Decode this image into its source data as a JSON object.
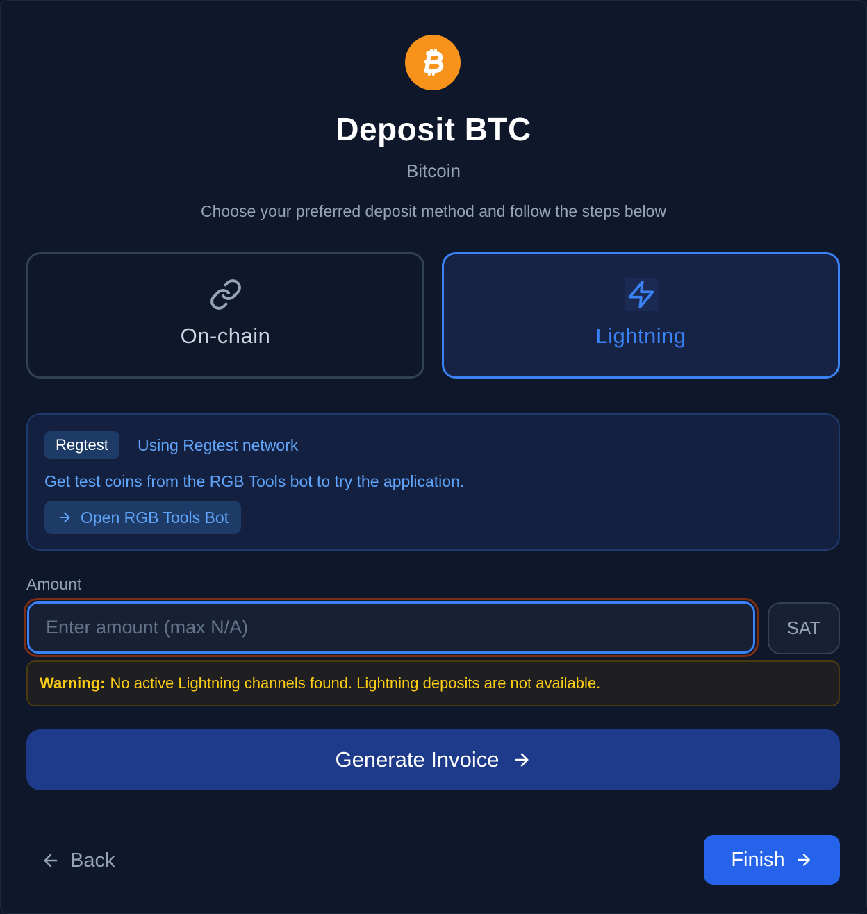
{
  "header": {
    "logo_icon": "bitcoin-icon",
    "logo_color": "#f7931a",
    "title": "Deposit BTC",
    "subtitle": "Bitcoin",
    "instructions": "Choose your preferred deposit method and follow the steps below"
  },
  "methods": [
    {
      "label": "On-chain",
      "icon": "link-icon",
      "selected": false
    },
    {
      "label": "Lightning",
      "icon": "lightning-icon",
      "selected": true
    }
  ],
  "regtest": {
    "badge": "Regtest",
    "network_text": "Using Regtest network",
    "description": "Get test coins from the RGB Tools bot to try the application.",
    "bot_button_label": "Open RGB Tools Bot"
  },
  "amount": {
    "label": "Amount",
    "placeholder": "Enter amount (max N/A)",
    "value": "",
    "unit": "SAT"
  },
  "warning": {
    "prefix": "Warning:",
    "message": "No active Lightning channels found. Lightning deposits are not available."
  },
  "actions": {
    "generate_label": "Generate Invoice",
    "back_label": "Back",
    "finish_label": "Finish"
  },
  "colors": {
    "accent": "#3b82f6",
    "background": "#0f172a",
    "warning": "#facc15"
  }
}
